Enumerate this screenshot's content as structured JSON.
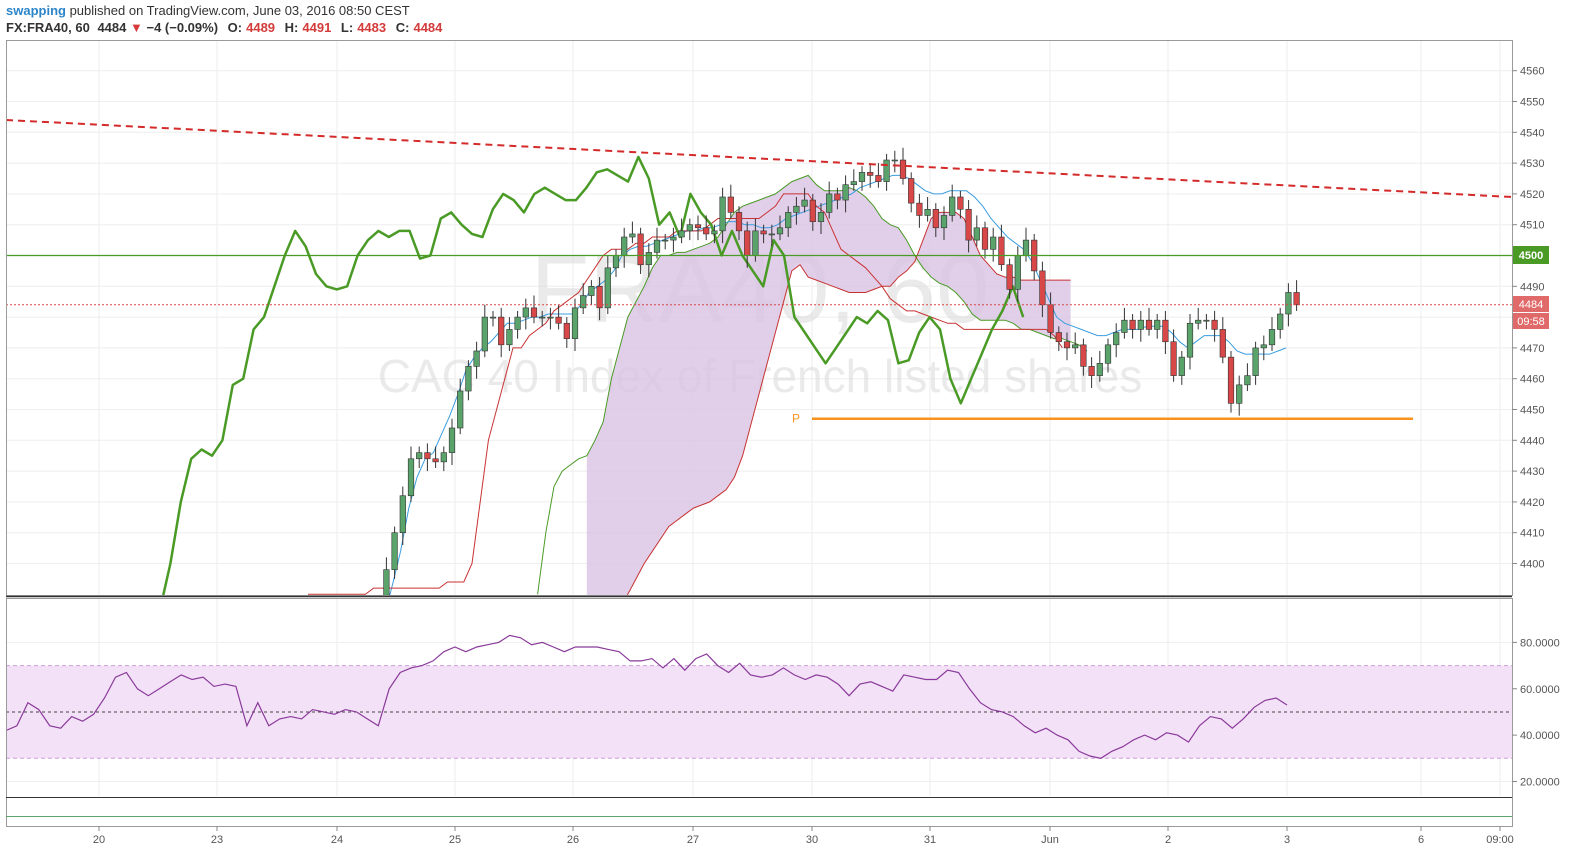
{
  "header": {
    "username": "swapping",
    "published_text": "published on TradingView.com, June 03, 2016 08:50 CEST",
    "symbol": "FX:FRA40, 60",
    "last": "4484",
    "change": "−4 (−0.09%)",
    "o_label": "O:",
    "o_value": "4489",
    "h_label": "H:",
    "h_value": "4491",
    "l_label": "L:",
    "l_value": "4483",
    "c_label": "C:",
    "c_value": "4484"
  },
  "watermark": {
    "symbol": "FRA40, 60",
    "description": "CAC 40 Index of French listed shares"
  },
  "labels": {
    "level_4500": "4500",
    "last_price": "4484",
    "countdown": "09:58",
    "pivot": "P"
  },
  "colors": {
    "up": "#5aa36b",
    "down": "#d94848",
    "chikou": "#4a9a26",
    "tenkan": "#3a9ddf",
    "kijun": "#c83232",
    "cloud": "#d9c3e3",
    "trend": "#d42a2a",
    "pivot": "#f7931e",
    "rsi": "#8a3a9a",
    "rsi_band": "#f3e1f7"
  },
  "chart_data": [
    {
      "type": "candlestick",
      "title": "",
      "symbol": "FX:FRA40",
      "timeframe": "60",
      "x_ticks": [
        "20",
        "23",
        "24",
        "25",
        "26",
        "27",
        "30",
        "31",
        "Jun",
        "2",
        "3",
        "6",
        "09:00"
      ],
      "ylim": [
        4390,
        4566
      ],
      "y_ticks": [
        4400,
        4410,
        4420,
        4430,
        4440,
        4450,
        4460,
        4470,
        4480,
        4490,
        4500,
        4510,
        4520,
        4530,
        4540,
        4550,
        4560
      ],
      "y_tick_labels": [
        "4400",
        "4410",
        "4420",
        "4430",
        "4440",
        "4450",
        "4460",
        "4470",
        "4480",
        "4490",
        "4500",
        "4510",
        "4520",
        "4530",
        "4540",
        "4550",
        "4560"
      ],
      "horizontal_level": 4500,
      "last_price": 4484,
      "pivot_level": 4447,
      "trendline": {
        "start": 4544,
        "end": 4519
      },
      "closes": [
        4375,
        4386,
        4398,
        4410,
        4422,
        4434,
        4436,
        4434,
        4433,
        4436,
        4444,
        4456,
        4464,
        4469,
        4480,
        4480,
        4471,
        4476,
        4480,
        4483,
        4480,
        4480,
        4480,
        4478,
        4473,
        4483,
        4487,
        4490,
        4483,
        4496,
        4500,
        4506,
        4507,
        4497,
        4501,
        4505,
        4505,
        4506,
        4508,
        4510,
        4509,
        4507,
        4508,
        4519,
        4514,
        4508,
        4500,
        4508,
        4507,
        4507,
        4509,
        4514,
        4516,
        4518,
        4511,
        4514,
        4520,
        4518,
        4523,
        4524,
        4527,
        4526,
        4524,
        4531,
        4531,
        4525,
        4517,
        4513,
        4515,
        4509,
        4513,
        4519,
        4515,
        4505,
        4509,
        4502,
        4506,
        4497,
        4489,
        4500,
        4505,
        4495,
        4484,
        4475,
        4472,
        4470,
        4471,
        4464,
        4461,
        4465,
        4471,
        4475,
        4479,
        4476,
        4479,
        4476,
        4479,
        4472,
        4461,
        4467,
        4478,
        4479,
        4479,
        4476,
        4467,
        4452,
        4458,
        4461,
        4470,
        4471,
        4476,
        4481,
        4488,
        4484
      ],
      "ichimoku": {
        "tenkan": [
          4376,
          4383,
          4393,
          4404,
          4418,
          4428,
          4434,
          4436,
          4442,
          4448,
          4455,
          4463,
          4467,
          4470,
          4472,
          4475,
          4478,
          4478,
          4479,
          4480,
          4480,
          4481,
          4481,
          4481,
          4481,
          4484,
          4488,
          4490,
          4492,
          4495,
          4500,
          4502,
          4503,
          4503,
          4504,
          4505,
          4506,
          4507,
          4508,
          4508,
          4509,
          4509,
          4510,
          4511,
          4511,
          4510,
          4510,
          4509,
          4509,
          4510,
          4512,
          4513,
          4514,
          4515,
          4516,
          4517,
          4518,
          4519,
          4520,
          4522,
          4523,
          4524,
          4525,
          4526,
          4526,
          4525,
          4523,
          4521,
          4520,
          4520,
          4521,
          4521,
          4521,
          4519,
          4516,
          4512,
          4509,
          4506,
          4504,
          4502,
          4498,
          4492,
          4486,
          4480,
          4478,
          4477,
          4476,
          4475,
          4474,
          4474,
          4475,
          4476,
          4476,
          4476,
          4477,
          4477,
          4477,
          4475,
          4472,
          4470,
          4472,
          4474,
          4474,
          4474,
          4472,
          4469,
          4468,
          4468,
          4468,
          4468,
          4469,
          4470
        ],
        "kijun": [
          4390,
          4390,
          4390,
          4390,
          4390,
          4390,
          4390,
          4390,
          4392,
          4392,
          4392,
          4392,
          4392,
          4392,
          4392,
          4392,
          4392,
          4394,
          4394,
          4394,
          4400,
          4420,
          4440,
          4450,
          4460,
          4470,
          4470,
          4474,
          4476,
          4478,
          4482,
          4484,
          4486,
          4488,
          4492,
          4496,
          4500,
          4502,
          4502,
          4502,
          4504,
          4504,
          4506,
          4506,
          4506,
          4508,
          4508,
          4508,
          4508,
          4510,
          4512,
          4512,
          4512,
          4512,
          4512,
          4512,
          4514,
          4516,
          4520,
          4520,
          4520,
          4520,
          4516,
          4514,
          4508,
          4502,
          4500,
          4498,
          4496,
          4493,
          4490,
          4486,
          4484,
          4482,
          4482,
          4481,
          4480,
          4479,
          4478,
          4478,
          4476,
          4476,
          4476,
          4476,
          4476,
          4476,
          4476,
          4476,
          4476,
          4476,
          4476,
          4474,
          4470
        ],
        "senkou_a": [
          4390,
          4410,
          4425,
          4430,
          4432,
          4434,
          4435,
          4440,
          4446,
          4460,
          4470,
          4480,
          4485,
          4490,
          4496,
          4500,
          4500,
          4501,
          4501,
          4502,
          4503,
          4504,
          4506,
          4510,
          4514,
          4516,
          4517,
          4518,
          4519,
          4520,
          4522,
          4524,
          4525,
          4526,
          4523,
          4521,
          4521,
          4521,
          4522,
          4521,
          4519,
          4516,
          4512,
          4510,
          4509,
          4505,
          4500,
          4496,
          4493,
          4491,
          4490,
          4488,
          4485,
          4481,
          4479,
          4479,
          4479,
          4479,
          4478,
          4476,
          4476,
          4475,
          4474,
          4473,
          4473,
          4472,
          4471,
          4469
        ],
        "senkou_b": [
          4380,
          4380,
          4380,
          4380,
          4385,
          4390,
          4395,
          4400,
          4404,
          4408,
          4412,
          4414,
          4416,
          4418,
          4419,
          4420,
          4422,
          4424,
          4428,
          4435,
          4445,
          4455,
          4465,
          4475,
          4485,
          4495,
          4497,
          4493,
          4492,
          4491,
          4490,
          4489,
          4488,
          4488,
          4488,
          4489,
          4490,
          4490,
          4493,
          4495,
          4498,
          4505,
          4512,
          4514,
          4514,
          4514,
          4512,
          4506,
          4500,
          4497,
          4494,
          4493,
          4493,
          4492,
          4492,
          4492,
          4492,
          4492,
          4492,
          4492
        ]
      },
      "chikou": [
        4385,
        4400,
        4420,
        4434,
        4437,
        4435,
        4440,
        4458,
        4460,
        4476,
        4480,
        4490,
        4500,
        4508,
        4503,
        4494,
        4490,
        4489,
        4490,
        4500,
        4505,
        4508,
        4506,
        4508,
        4508,
        4499,
        4500,
        4512,
        4514,
        4510,
        4507,
        4506,
        4515,
        4520,
        4518,
        4514,
        4520,
        4522,
        4520,
        4518,
        4518,
        4522,
        4527,
        4528,
        4526,
        4524,
        4532,
        4525,
        4510,
        4514,
        4506,
        4520,
        4514,
        4510,
        4500,
        4508,
        4500,
        4495,
        4490,
        4505,
        4500,
        4480,
        4475,
        4470,
        4465,
        4470,
        4475,
        4480,
        4478,
        4482,
        4479,
        4465,
        4466,
        4475,
        4480,
        4476,
        4460,
        4452,
        4460,
        4468,
        4476,
        4482,
        4490,
        4480
      ]
    },
    {
      "type": "line",
      "title": "",
      "indicator": "RSI",
      "ylim": [
        14,
        90
      ],
      "y_ticks": [
        20,
        40,
        60,
        80
      ],
      "y_tick_labels": [
        "20.0000",
        "40.0000",
        "60.0000",
        "80.0000"
      ],
      "band": [
        30,
        70
      ],
      "midline": 50,
      "values": [
        42,
        44,
        54,
        51,
        44,
        43,
        48,
        46,
        49,
        56,
        65,
        67,
        60,
        57,
        60,
        63,
        66,
        64,
        65,
        61,
        62,
        61,
        44,
        54,
        44,
        47,
        48,
        47,
        51,
        50,
        49,
        51,
        50,
        47,
        44,
        60,
        67,
        69,
        70,
        72,
        76,
        78,
        76,
        78,
        79,
        80,
        83,
        82,
        79,
        80,
        78,
        76,
        78,
        78,
        78,
        77,
        76,
        72,
        72,
        73,
        69,
        73,
        68,
        73,
        75,
        70,
        67,
        71,
        66,
        65,
        66,
        69,
        66,
        64,
        66,
        65,
        62,
        57,
        62,
        63,
        61,
        59,
        66,
        65,
        64,
        64,
        68,
        67,
        60,
        54,
        51,
        50,
        48,
        44,
        41,
        43,
        40,
        38,
        33,
        31,
        30,
        33,
        35,
        38,
        40,
        38,
        41,
        40,
        37,
        44,
        48,
        47,
        43,
        47,
        52,
        55,
        56,
        53
      ]
    }
  ]
}
